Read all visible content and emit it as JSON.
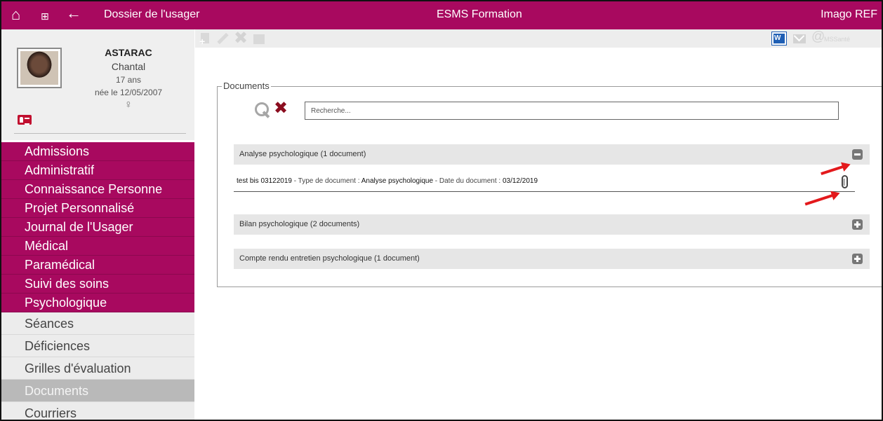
{
  "topbar": {
    "left_title": "Dossier de l'usager",
    "center_title": "ESMS Formation",
    "right_title": "Imago REF",
    "home_icon": "⌂",
    "grid_icon": "⊞",
    "back_icon": "←"
  },
  "patient": {
    "last_name": "ASTARAC",
    "first_name": "Chantal",
    "age": "17 ans",
    "birth": "née le 12/05/2007",
    "sex_symbol": "♀"
  },
  "menu": {
    "sections": [
      "Admissions",
      "Administratif",
      "Connaissance Personne",
      "Projet Personnalisé",
      "Journal de l'Usager",
      "Médical",
      "Paramédical",
      "Suivi des soins",
      "Psychologique"
    ],
    "sub_items": [
      "Séances",
      "Déficiences",
      "Grilles d'évaluation",
      "Documents",
      "Courriers"
    ]
  },
  "toolbar": {
    "mssante": "MSSanté",
    "delete_glyph": "✖",
    "at_glyph": "@"
  },
  "documents": {
    "legend": "Documents",
    "search_placeholder": "Recherche...",
    "clear_glyph": "✖",
    "groups": [
      "Analyse psychologique (1 document)",
      "Bilan psychologique (2 documents)",
      "Compte rendu entretien psychologique (1 document)"
    ],
    "row": {
      "name": "test bis 03122019",
      "type_label": " - Type de document : ",
      "type_value": "Analyse psychologique",
      "date_label": " - Date du document : ",
      "date_value": "03/12/2019"
    }
  },
  "colors": {
    "brand": "#a8095f",
    "annotation_arrow": "#e3191c"
  }
}
